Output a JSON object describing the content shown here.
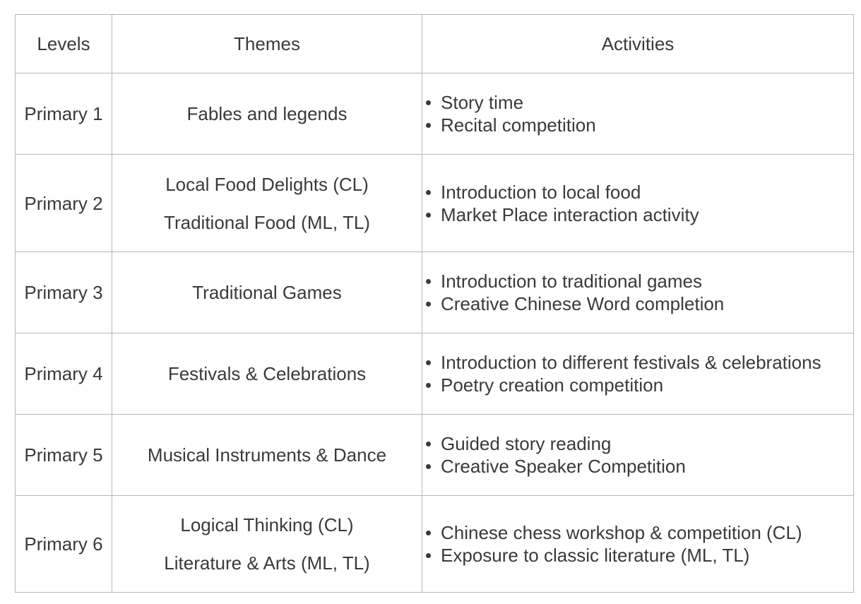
{
  "headers": {
    "levels": "Levels",
    "themes": "Themes",
    "activities": "Activities"
  },
  "rows": [
    {
      "level": "Primary 1",
      "themes": [
        "Fables and legends"
      ],
      "activities": [
        "Story time",
        "Recital competition"
      ]
    },
    {
      "level": "Primary 2",
      "themes": [
        "Local Food Delights (CL)",
        "Traditional Food (ML, TL)"
      ],
      "activities": [
        "Introduction to local food",
        "Market Place interaction activity"
      ]
    },
    {
      "level": "Primary 3",
      "themes": [
        "Traditional Games"
      ],
      "activities": [
        "Introduction to traditional games",
        "Creative Chinese Word completion"
      ]
    },
    {
      "level": "Primary 4",
      "themes": [
        "Festivals & Celebrations"
      ],
      "activities": [
        "Introduction to different festivals & celebrations",
        "Poetry creation competition"
      ]
    },
    {
      "level": "Primary 5",
      "themes": [
        "Musical Instruments & Dance"
      ],
      "activities": [
        "Guided story reading",
        "Creative Speaker Competition"
      ]
    },
    {
      "level": "Primary 6",
      "themes": [
        "Logical Thinking (CL)",
        "Literature & Arts (ML, TL)"
      ],
      "activities": [
        "Chinese chess workshop & competition (CL)",
        "Exposure to classic literature (ML, TL)"
      ]
    }
  ]
}
